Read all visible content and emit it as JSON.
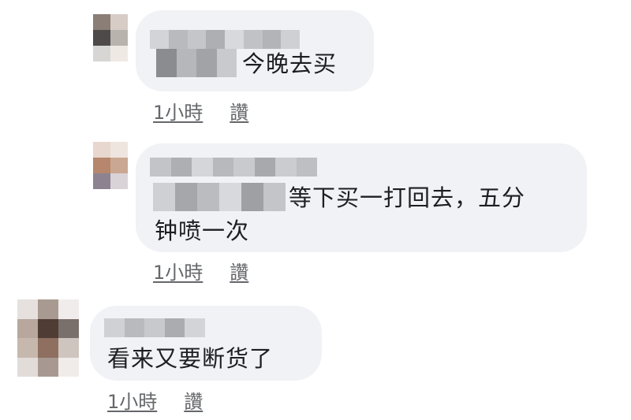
{
  "comments": [
    {
      "text_line1": "今晚去买",
      "text_line2": "",
      "time": "1小時",
      "like": "讚"
    },
    {
      "text_line1": "等下买一打回去，五分",
      "text_line2": "钟喷一次",
      "time": "1小時",
      "like": "讚"
    },
    {
      "text_line1": "看来又要断货了",
      "text_line2": "",
      "time": "1小時",
      "like": "讚"
    }
  ]
}
